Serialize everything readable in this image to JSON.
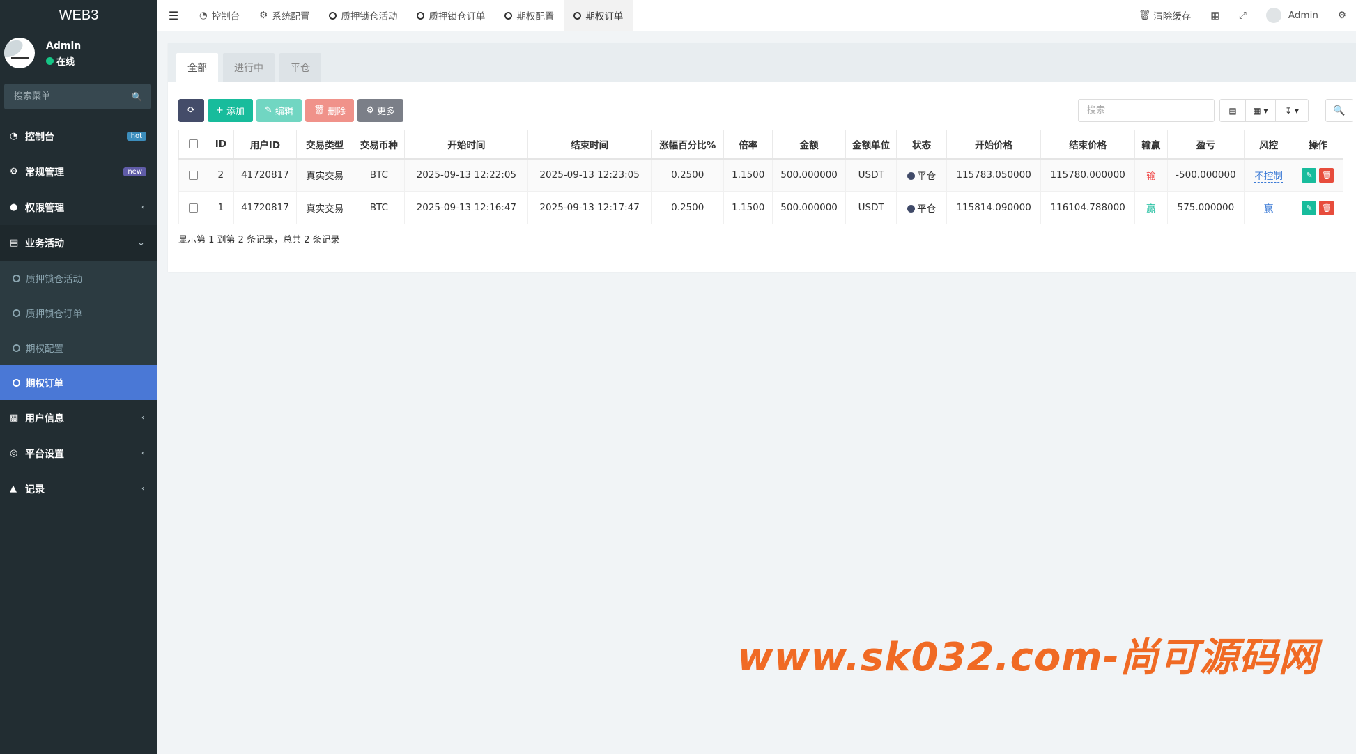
{
  "brand": "WEB3",
  "user": {
    "name": "Admin",
    "status": "在线"
  },
  "sidebar": {
    "search_placeholder": "搜索菜单",
    "items": [
      {
        "label": "控制台",
        "icon": "dashboard-icon",
        "badge": "hot",
        "badge_color": "#3c8dbc"
      },
      {
        "label": "常规管理",
        "icon": "cogs-icon",
        "badge": "new",
        "badge_color": "#605ca8"
      },
      {
        "label": "权限管理",
        "icon": "group-icon"
      },
      {
        "label": "业务活动",
        "icon": "list-alt-icon",
        "open": true
      },
      {
        "label": "用户信息",
        "icon": "user-card-icon"
      },
      {
        "label": "平台设置",
        "icon": "settings-icon"
      },
      {
        "label": "记录",
        "icon": "area-chart-icon"
      }
    ],
    "sub_items": [
      "质押锁仓活动",
      "质押锁仓订单",
      "期权配置",
      "期权订单"
    ],
    "active_sub": "期权订单"
  },
  "topbar": {
    "tabs": [
      "控制台",
      "系统配置",
      "质押锁仓活动",
      "质押锁仓订单",
      "期权配置",
      "期权订单"
    ],
    "active_tab": "期权订单",
    "clear_cache": "清除缓存",
    "admin": "Admin"
  },
  "panel": {
    "tabs": [
      "全部",
      "进行中",
      "平仓"
    ],
    "active_tab": "全部",
    "buttons": {
      "add": "添加",
      "edit": "编辑",
      "delete": "删除",
      "more": "更多"
    },
    "search_placeholder": "搜索",
    "summary": "显示第 1 到第 2 条记录，总共 2 条记录"
  },
  "table": {
    "columns": [
      "ID",
      "用户ID",
      "交易类型",
      "交易币种",
      "开始时间",
      "结束时间",
      "涨幅百分比%",
      "倍率",
      "金额",
      "金额单位",
      "状态",
      "开始价格",
      "结束价格",
      "输赢",
      "盈亏",
      "风控",
      "操作"
    ],
    "rows": [
      {
        "id": "2",
        "uid": "41720817",
        "type": "真实交易",
        "coin": "BTC",
        "start": "2025-09-13 12:22:05",
        "end": "2025-09-13 12:23:05",
        "pct": "0.2500",
        "rate": "1.1500",
        "amount": "500.000000",
        "unit": "USDT",
        "status": "平仓",
        "open": "115783.050000",
        "close": "115780.000000",
        "result": "输",
        "pnl": "-500.000000",
        "risk": "不控制"
      },
      {
        "id": "1",
        "uid": "41720817",
        "type": "真实交易",
        "coin": "BTC",
        "start": "2025-09-13 12:16:47",
        "end": "2025-09-13 12:17:47",
        "pct": "0.2500",
        "rate": "1.1500",
        "amount": "500.000000",
        "unit": "USDT",
        "status": "平仓",
        "open": "115814.090000",
        "close": "116104.788000",
        "result": "赢",
        "pnl": "575.000000",
        "risk": "赢"
      }
    ]
  },
  "watermark": "www.sk032.com-尚可源码网"
}
